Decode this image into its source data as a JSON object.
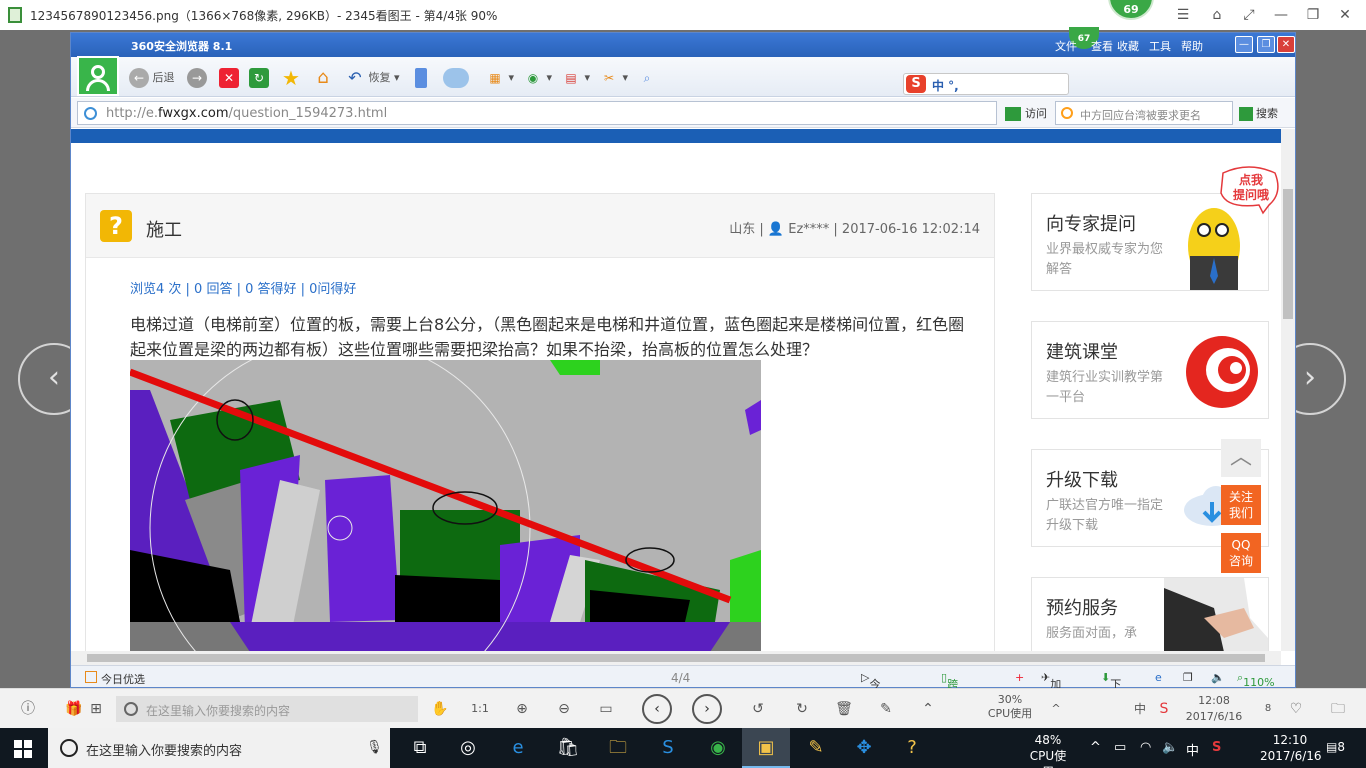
{
  "viewer": {
    "title": "1234567890123456.png（1366×768像素, 296KB）- 2345看图王 - 第4/4张 90%",
    "badge": "69",
    "counter": "4/4"
  },
  "browser": {
    "title": "360安全浏览器 8.1",
    "badge": "67",
    "menu": [
      "文件",
      "查看",
      "收藏",
      "工具",
      "帮助"
    ],
    "toolbar": {
      "back": "后退",
      "restore": "恢复"
    },
    "ime": "中 °,",
    "address": {
      "url_prefix": "http://e.",
      "url_domain": "fwxgx.com",
      "url_path": "/question_1594273.html",
      "go_label": "访问"
    },
    "search": {
      "placeholder": "中方回应台湾被要求更名",
      "button": "搜索"
    },
    "status": {
      "left": "今日优选",
      "center": "4/4",
      "live": "今日直播",
      "cross_screen": "跨屏浏览",
      "accelerator": "加速器",
      "download": "下载",
      "zoom": "110%"
    }
  },
  "question": {
    "title": "施工",
    "meta": "山东 | 👤 Ez**** | 2017-06-16 12:02:14",
    "stats": "浏览4 次 | 0 回答 | 0 答得好 | 0问得好",
    "body": "电梯过道（电梯前室）位置的板，需要上台8公分，（黑色圈起来是电梯和井道位置，蓝色圈起来是楼梯间位置，红色圈起来位置是梁的两边都有板）这些位置哪些需要把梁抬高？如果不抬梁，抬高板的位置怎么处理？"
  },
  "sidebar": [
    {
      "title": "向专家提问",
      "desc": "业界最权威专家为您解答"
    },
    {
      "title": "建筑课堂",
      "desc": "建筑行业实训教学第一平台"
    },
    {
      "title": "升级下载",
      "desc": "广联达官方唯一指定升级下载"
    },
    {
      "title": "预约服务",
      "desc": "服务面对面，承"
    }
  ],
  "mascot_bubble": "点我\n提问哦",
  "float_buttons": {
    "follow": "关注\n我们",
    "qq": "QQ\n咨询"
  },
  "viewer_bottom": {
    "search_placeholder": "在这里输入你要搜索的内容",
    "cpu_percent": "30%",
    "cpu_label": "CPU使用",
    "ime": "中",
    "time": "12:08",
    "date": "2017/6/16",
    "notif": "8"
  },
  "taskbar": {
    "search_placeholder": "在这里输入你要搜索的内容",
    "cpu_percent": "48%",
    "cpu_label": "CPU使用",
    "ime": "中",
    "time": "12:10",
    "date": "2017/6/16",
    "notif": "8"
  }
}
